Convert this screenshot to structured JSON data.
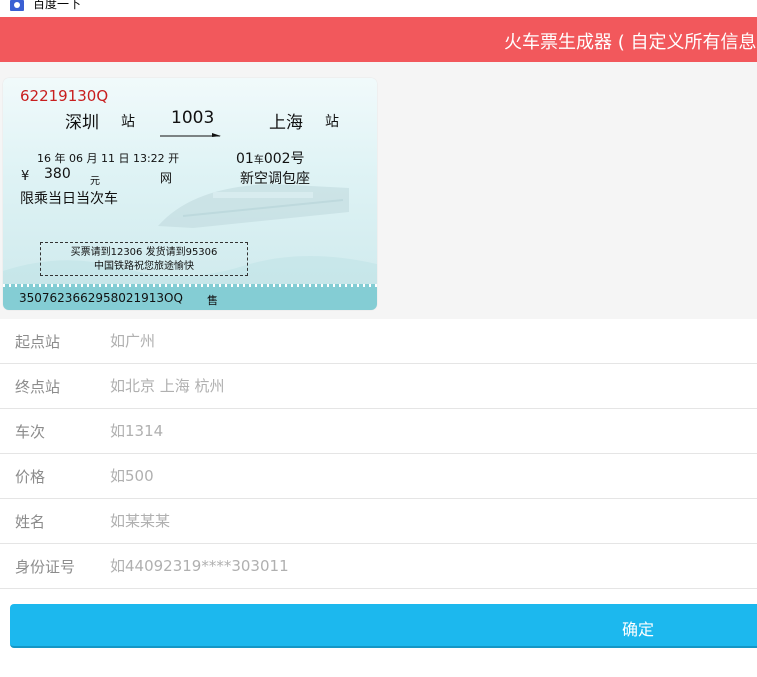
{
  "topbar": {
    "label": "百度一下"
  },
  "header": {
    "title": "火车票生成器 ( 自定义所有信息"
  },
  "ticket": {
    "code": "62219130Q",
    "from_station": "深圳",
    "station_suffix": "站",
    "train_no": "1003",
    "to_station": "上海",
    "date": "16 年 06 月 11 日  13:22 开",
    "car_no": "01",
    "car_suffix": "车",
    "seat_no": "002号",
    "yen_sign": "¥",
    "price": "380",
    "yuan": "元",
    "wang": "网",
    "seat_class": "新空调包座",
    "limit_text": "限乘当日当次车",
    "notice_line1": "买票请到12306  发货请到95306",
    "notice_line2": "中国铁路祝您旅途愉快",
    "serial": "3507623662958021913OQ",
    "sell": "售"
  },
  "form": {
    "fields": [
      {
        "label": "起点站",
        "placeholder": "如广州"
      },
      {
        "label": "终点站",
        "placeholder": "如北京 上海 杭州"
      },
      {
        "label": "车次",
        "placeholder": "如1314"
      },
      {
        "label": "价格",
        "placeholder": "如500"
      },
      {
        "label": "姓名",
        "placeholder": "如某某某"
      },
      {
        "label": "身份证号",
        "placeholder": "如44092319****303011"
      }
    ],
    "submit_label": "确定"
  },
  "colors": {
    "header_bg": "#f2585c",
    "button_bg": "#1cb8ee",
    "ticket_code": "#c81e1e",
    "ticket_band": "#84cdd4"
  }
}
